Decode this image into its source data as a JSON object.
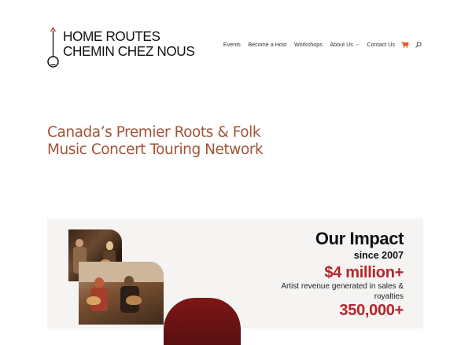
{
  "logo": {
    "line1": "HOME ROUTES",
    "line2": "CHEMIN CHEZ NOUS",
    "mark_icon": "banjo-logo-icon"
  },
  "nav": {
    "items": [
      {
        "label": "Events",
        "has_dropdown": false
      },
      {
        "label": "Become a Host",
        "has_dropdown": false
      },
      {
        "label": "Workshops",
        "has_dropdown": false
      },
      {
        "label": "About Us",
        "has_dropdown": true
      },
      {
        "label": "Contact Us",
        "has_dropdown": false
      }
    ],
    "cart_icon": "cart-icon",
    "search_icon": "search-icon"
  },
  "hero": {
    "title_line1": "Canada’s Premier Roots & Folk",
    "title_line2": "Music Concert Touring Network"
  },
  "impact": {
    "title": "Our Impact",
    "since": "since 2007",
    "stat1_value": "$4 million+",
    "stat1_desc": "Artist revenue generated in sales & royalties",
    "stat2_value": "350,000+"
  },
  "colors": {
    "accent_text": "#a0553b",
    "stat_red": "#b3262b",
    "cart_orange": "#e45a29",
    "impact_bg": "#f5f4f2"
  }
}
